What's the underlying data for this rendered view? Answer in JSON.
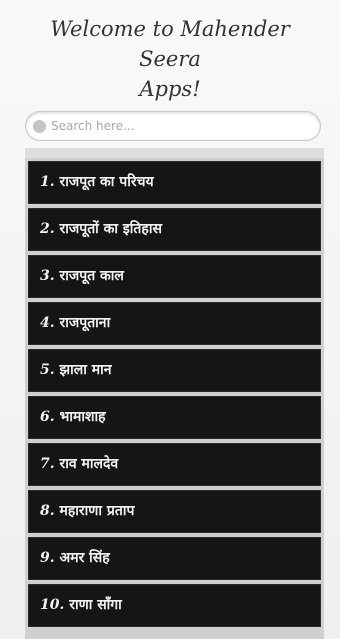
{
  "header": {
    "title_line1": "Welcome to Mahender Seera",
    "title_line2": "Apps!"
  },
  "search": {
    "placeholder": "Search here...",
    "icon": "search-icon"
  },
  "colors": {
    "item_background": "#151515",
    "item_text": "#f2f2f2"
  },
  "list": {
    "items": [
      {
        "number": "1.",
        "label": "राजपूत का परिचय"
      },
      {
        "number": "2.",
        "label": "राजपूतों का इतिहास"
      },
      {
        "number": "3.",
        "label": "राजपूत काल"
      },
      {
        "number": "4.",
        "label": "राजपूताना"
      },
      {
        "number": "5.",
        "label": "झाला मान"
      },
      {
        "number": "6.",
        "label": "भामाशाह"
      },
      {
        "number": "7.",
        "label": "राव मालदेव"
      },
      {
        "number": "8.",
        "label": "महाराणा प्रताप"
      },
      {
        "number": "9.",
        "label": "अमर सिंह"
      },
      {
        "number": "10.",
        "label": "राणा साँगा"
      }
    ]
  }
}
